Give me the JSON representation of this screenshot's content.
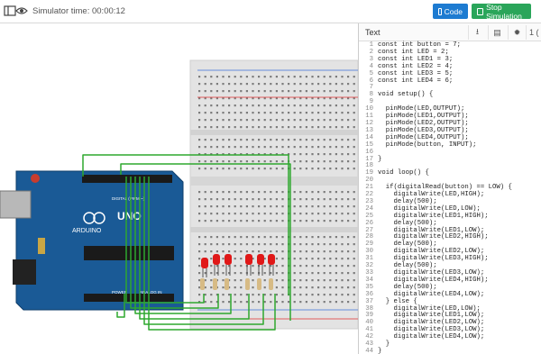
{
  "toolbar": {
    "left_icons": [
      "panel-icon",
      "eye-icon"
    ],
    "sim_time_label": "Simulator time: 00:00:12",
    "code_button_label": "Code",
    "stop_button_label": "Stop Simulation",
    "colors": {
      "code": "#1d7bd1",
      "stop": "#2aa55a"
    }
  },
  "code_panel": {
    "mode_label": "Text",
    "header_icons": [
      "download-icon",
      "upload-icon",
      "bug-icon"
    ],
    "page_indicator": "1 ("
  },
  "board": {
    "name": "ARDUINO",
    "model": "UNO",
    "digital_label": "DIGITAL (PWM ~)",
    "power_label": "POWER",
    "analog_label": "ANALOG IN",
    "colors": {
      "board": "#1a5a96",
      "wire": "#2ea82e",
      "led": "#e01818"
    }
  },
  "code": {
    "lines": [
      "const int button = 7;",
      "const int LED = 2;",
      "const int LED1 = 3;",
      "const int LED2 = 4;",
      "const int LED3 = 5;",
      "const int LED4 = 6;",
      "",
      "void setup() {",
      "",
      "  pinMode(LED,OUTPUT);",
      "  pinMode(LED1,OUTPUT);",
      "  pinMode(LED2,OUTPUT);",
      "  pinMode(LED3,OUTPUT);",
      "  pinMode(LED4,OUTPUT);",
      "  pinMode(button, INPUT);",
      "",
      "}",
      "",
      "void loop() {",
      "",
      "  if(digitalRead(button) == LOW) {",
      "    digitalWrite(LED,HIGH);",
      "    delay(500);",
      "    digitalWrite(LED,LOW);",
      "    digitalWrite(LED1,HIGH);",
      "    delay(500);",
      "    digitalWrite(LED1,LOW);",
      "    digitalWrite(LED2,HIGH);",
      "    delay(500);",
      "    digitalWrite(LED2,LOW);",
      "    digitalWrite(LED3,HIGH);",
      "    delay(500);",
      "    digitalWrite(LED3,LOW);",
      "    digitalWrite(LED4,HIGH);",
      "    delay(500);",
      "    digitalWrite(LED4,LOW);",
      "  } else {",
      "    digitalWrite(LED,LOW);",
      "    digitalWrite(LED1,LOW);",
      "    digitalWrite(LED2,LOW);",
      "    digitalWrite(LED3,LOW);",
      "    digitalWrite(LED4,LOW);",
      "  }",
      "}",
      ""
    ]
  }
}
